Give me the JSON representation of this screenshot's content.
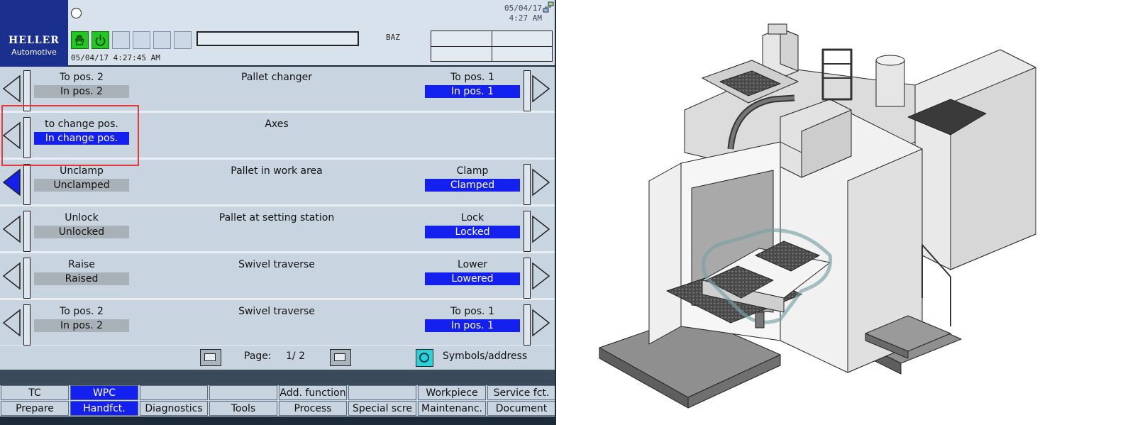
{
  "header": {
    "brand": "HELLER",
    "brand_sub": "Automotive",
    "date_top": "05/04/17",
    "time_top": "4:27 AM",
    "timestamp": "05/04/17 4:27:45 AM",
    "mode": "BAZ"
  },
  "colors": {
    "active_blue": "#1420ee",
    "inactive_gray": "#a8b0b8",
    "logo_blue": "#1a2f8e",
    "status_green": "#22c722",
    "highlight_red": "#e03a3a",
    "panel_bg": "#c8d4e0"
  },
  "icons": {
    "hand_stop": "hand-stop-icon",
    "power": "power-icon",
    "network": "network-icon",
    "page_up": "page-up-icon",
    "page_down": "page-down-icon",
    "symbols": "symbols-address-icon"
  },
  "rows": [
    {
      "title": "Pallet changer",
      "left_cmd": "To pos. 2",
      "left_state": "In pos. 2",
      "left_state_active": false,
      "right_cmd": "To pos. 1",
      "right_state": "In pos. 1",
      "right_state_active": true,
      "left_arrow_filled": false
    },
    {
      "title": "Axes",
      "left_cmd": "to change pos.",
      "left_state": "In change pos.",
      "left_state_active": true,
      "right_cmd": "",
      "right_state": "",
      "right_state_active": false,
      "left_arrow_filled": false
    },
    {
      "title": "Pallet in work area",
      "left_cmd": "Unclamp",
      "left_state": "Unclamped",
      "left_state_active": false,
      "right_cmd": "Clamp",
      "right_state": "Clamped",
      "right_state_active": true,
      "left_arrow_filled": true
    },
    {
      "title": "Pallet at setting station",
      "left_cmd": "Unlock",
      "left_state": "Unlocked",
      "left_state_active": false,
      "right_cmd": "Lock",
      "right_state": "Locked",
      "right_state_active": true,
      "left_arrow_filled": false
    },
    {
      "title": "Swivel traverse",
      "left_cmd": "Raise",
      "left_state": "Raised",
      "left_state_active": false,
      "right_cmd": "Lower",
      "right_state": "Lowered",
      "right_state_active": true,
      "left_arrow_filled": false
    },
    {
      "title": "Swivel traverse",
      "left_cmd": "To pos. 2",
      "left_state": "In pos. 2",
      "left_state_active": false,
      "right_cmd": "To pos. 1",
      "right_state": "In pos. 1",
      "right_state_active": true,
      "left_arrow_filled": false
    }
  ],
  "pager": {
    "label": "Page:",
    "value": "1/ 2",
    "symbols_label": "Symbols/address"
  },
  "softkeys_top": [
    {
      "label": "TC",
      "active": false
    },
    {
      "label": "WPC",
      "active": true
    },
    {
      "label": "",
      "active": false
    },
    {
      "label": "",
      "active": false
    },
    {
      "label": "Add. function",
      "active": false
    },
    {
      "label": "",
      "active": false
    },
    {
      "label": "Workpiece",
      "active": false
    },
    {
      "label": "Service fct.",
      "active": false
    }
  ],
  "softkeys_bottom": [
    {
      "label": "Prepare",
      "active": false
    },
    {
      "label": "Handfct.",
      "active": true
    },
    {
      "label": "Diagnostics",
      "active": false
    },
    {
      "label": "Tools",
      "active": false
    },
    {
      "label": "Process",
      "active": false
    },
    {
      "label": "Special scre",
      "active": false
    },
    {
      "label": "Maintenanc.",
      "active": false
    },
    {
      "label": "Document",
      "active": false
    }
  ]
}
